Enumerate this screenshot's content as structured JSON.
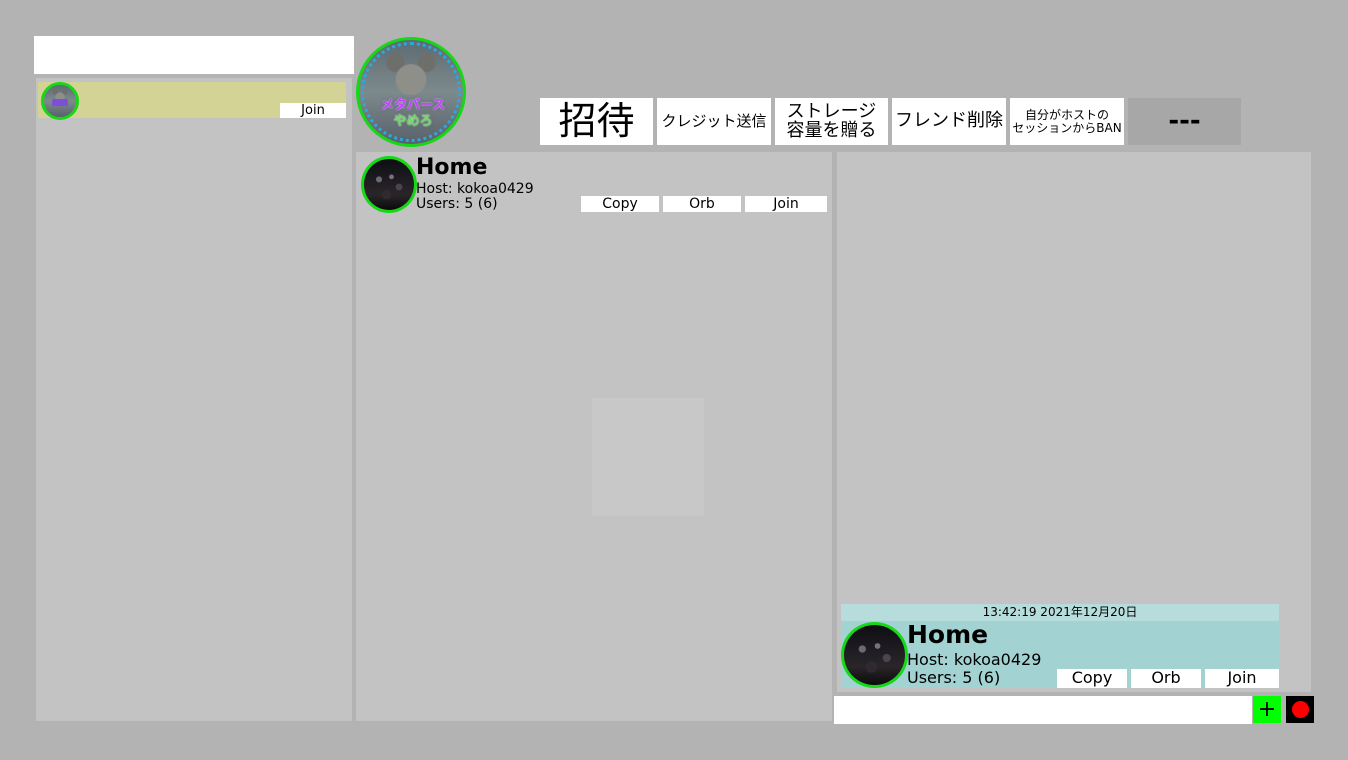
{
  "search": {
    "value": "",
    "placeholder": ""
  },
  "friends_list": {
    "items": [
      {
        "join_label": "Join",
        "highlight_color": "#d3d395"
      }
    ]
  },
  "profile": {
    "badge_text_top": "メタバース",
    "badge_text_bottom": "やめろ"
  },
  "toolbar": {
    "invite_label": "招待",
    "send_credit_label": "クレジット送信",
    "gift_storage_line1": "ストレージ",
    "gift_storage_line2": "容量を贈る",
    "remove_friend_label": "フレンド削除",
    "ban_line1": "自分がホストの",
    "ban_line2": "セッションからBAN",
    "more_label": "---"
  },
  "session": {
    "name": "Home",
    "host": "Host: kokoa0429",
    "users": "Users: 5 (6)",
    "copy_label": "Copy",
    "orb_label": "Orb",
    "join_label": "Join"
  },
  "chat": {
    "messages": [
      {
        "timestamp": "13:42:19 2021年12月20日",
        "session_name": "Home",
        "host": "Host: kokoa0429",
        "users": "Users: 5 (6)",
        "copy_label": "Copy",
        "orb_label": "Orb",
        "join_label": "Join"
      }
    ],
    "input_value": "",
    "add_label": "+",
    "colors": {
      "message_bg": "#a2d2d2",
      "add_bg": "#00ff00",
      "record": "#ff0000"
    }
  }
}
